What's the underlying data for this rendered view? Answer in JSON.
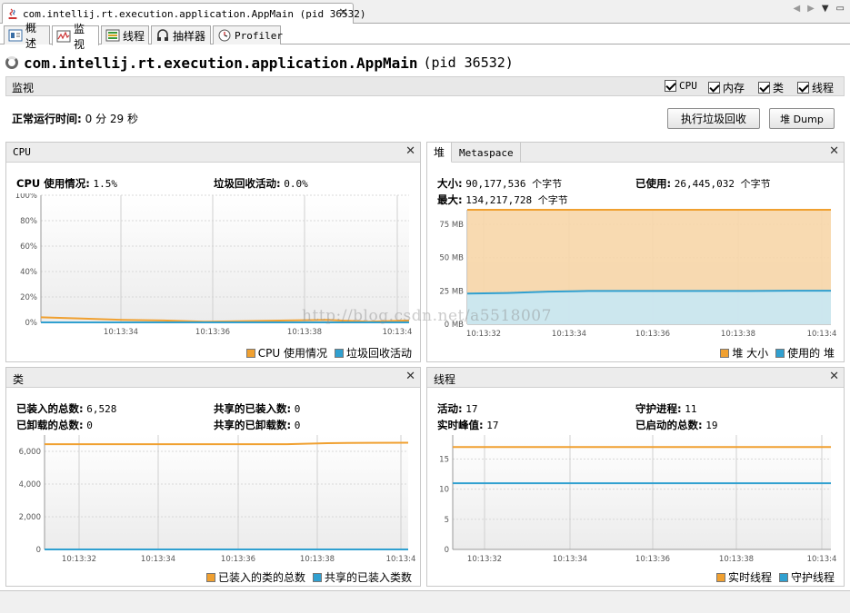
{
  "document_tab": {
    "title": "com.intellij.rt.execution.application.AppMain (pid 36532)",
    "close": "✕"
  },
  "view_tabs": [
    {
      "label": "概述"
    },
    {
      "label": "监视"
    },
    {
      "label": "线程"
    },
    {
      "label": "抽样器"
    },
    {
      "label": "Profiler"
    }
  ],
  "header": {
    "app_name": "com.intellij.rt.execution.application.AppMain",
    "pid": "(pid 36532)"
  },
  "monitor_bar": {
    "label": "监视",
    "checkboxes": [
      {
        "label": "CPU",
        "checked": true
      },
      {
        "label": "内存",
        "checked": true
      },
      {
        "label": "类",
        "checked": true
      },
      {
        "label": "线程",
        "checked": true
      }
    ]
  },
  "uptime": {
    "label": "正常运行时间:",
    "value": "0 分 29 秒"
  },
  "buttons": {
    "gc": "执行垃圾回收",
    "heap_dump": "堆 Dump"
  },
  "cpu_panel": {
    "title": "CPU",
    "usage_label": "CPU 使用情况:",
    "usage_value": "1.5%",
    "gc_label": "垃圾回收活动:",
    "gc_value": "0.0%",
    "legend": [
      "CPU 使用情况",
      "垃圾回收活动"
    ]
  },
  "heap_panel": {
    "tabs": [
      "堆",
      "Metaspace"
    ],
    "size_label": "大小:",
    "size_value": "90,177,536 个字节",
    "used_label": "已使用:",
    "used_value": "26,445,032 个字节",
    "max_label": "最大:",
    "max_value": "134,217,728 个字节",
    "legend": [
      "堆 大小",
      "使用的 堆"
    ]
  },
  "classes_panel": {
    "title": "类",
    "loaded_label": "已装入的总数:",
    "loaded_value": "6,528",
    "unloaded_label": "已卸载的总数:",
    "unloaded_value": "0",
    "shared_loaded_label": "共享的已装入数:",
    "shared_loaded_value": "0",
    "shared_unloaded_label": "共享的已卸载数:",
    "shared_unloaded_value": "0",
    "legend": [
      "已装入的类的总数",
      "共享的已装入类数"
    ]
  },
  "threads_panel": {
    "title": "线程",
    "live_label": "活动:",
    "live_value": "17",
    "peak_label": "实时峰值:",
    "peak_value": "17",
    "daemon_label": "守护进程:",
    "daemon_value": "11",
    "started_label": "已启动的总数:",
    "started_value": "19",
    "legend": [
      "实时线程",
      "守护线程"
    ]
  },
  "colors": {
    "orange": "#f0a030",
    "blue": "#30a0d0",
    "orange_fill": "#f7d6a8",
    "blue_fill": "#c7e8f5"
  },
  "watermark": "http://blog.csdn.net/a5518007",
  "chart_data": [
    {
      "type": "line",
      "name": "cpu",
      "x": [
        "10:13:31",
        "10:13:32",
        "10:13:33",
        "10:13:34",
        "10:13:35",
        "10:13:36",
        "10:13:37",
        "10:13:38",
        "10:13:39",
        "10:13:40"
      ],
      "xticks": [
        "10:13:34",
        "10:13:36",
        "10:13:38",
        "10:13:4"
      ],
      "yticks": [
        "0%",
        "20%",
        "40%",
        "60%",
        "80%",
        "100%"
      ],
      "ylim": [
        0,
        100
      ],
      "series": [
        {
          "values": [
            4,
            3,
            2,
            1.5,
            0.5,
            1,
            1.5,
            2,
            0.5,
            1.5
          ],
          "color": "#f0a030"
        },
        {
          "values": [
            0,
            0,
            0,
            0,
            0,
            0,
            0,
            0,
            0,
            0
          ],
          "color": "#30a0d0"
        }
      ]
    },
    {
      "type": "area",
      "name": "heap",
      "x": [
        "10:13:31",
        "10:13:32",
        "10:13:33",
        "10:13:34",
        "10:13:35",
        "10:13:36",
        "10:13:37",
        "10:13:38",
        "10:13:39",
        "10:13:40"
      ],
      "xticks": [
        "10:13:32",
        "10:13:34",
        "10:13:36",
        "10:13:38",
        "10:13:4"
      ],
      "yticks": [
        "0 MB",
        "25 MB",
        "50 MB",
        "75 MB"
      ],
      "ylim": [
        0,
        86
      ],
      "series": [
        {
          "values": [
            86,
            86,
            86,
            86,
            86,
            86,
            86,
            86,
            86,
            86
          ],
          "color": "#f0a030",
          "fill": "#f7d6a8"
        },
        {
          "values": [
            23,
            23.5,
            24.5,
            25,
            25,
            25,
            25,
            25,
            25.2,
            25.2
          ],
          "color": "#30a0d0",
          "fill": "#c7e8f5"
        }
      ]
    },
    {
      "type": "line",
      "name": "classes",
      "x": [
        "10:13:31",
        "10:13:32",
        "10:13:33",
        "10:13:34",
        "10:13:35",
        "10:13:36",
        "10:13:37",
        "10:13:38",
        "10:13:39",
        "10:13:40"
      ],
      "xticks": [
        "10:13:32",
        "10:13:34",
        "10:13:36",
        "10:13:38",
        "10:13:4"
      ],
      "yticks": [
        "0",
        "2,000",
        "4,000",
        "6,000"
      ],
      "ylim": [
        0,
        7000
      ],
      "series": [
        {
          "values": [
            6440,
            6440,
            6440,
            6440,
            6440,
            6440,
            6440,
            6500,
            6520,
            6528
          ],
          "color": "#f0a030"
        },
        {
          "values": [
            0,
            0,
            0,
            0,
            0,
            0,
            0,
            0,
            0,
            0
          ],
          "color": "#30a0d0"
        }
      ]
    },
    {
      "type": "line",
      "name": "threads",
      "x": [
        "10:13:31",
        "10:13:32",
        "10:13:33",
        "10:13:34",
        "10:13:35",
        "10:13:36",
        "10:13:37",
        "10:13:38",
        "10:13:39",
        "10:13:40"
      ],
      "xticks": [
        "10:13:32",
        "10:13:34",
        "10:13:36",
        "10:13:38",
        "10:13:4"
      ],
      "yticks": [
        "0",
        "5",
        "10",
        "15"
      ],
      "ylim": [
        0,
        19
      ],
      "series": [
        {
          "values": [
            17,
            17,
            17,
            17,
            17,
            17,
            17,
            17,
            17,
            17
          ],
          "color": "#f0a030"
        },
        {
          "values": [
            11,
            11,
            11,
            11,
            11,
            11,
            11,
            11,
            11,
            11
          ],
          "color": "#30a0d0"
        }
      ]
    }
  ]
}
